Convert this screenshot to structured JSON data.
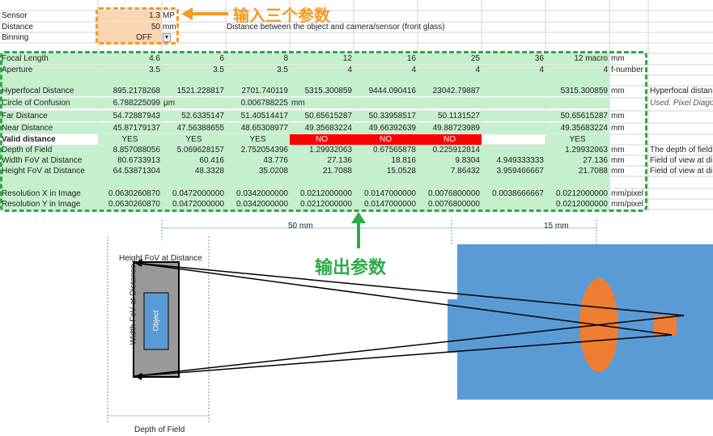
{
  "inputs": {
    "sensor": {
      "label": "Sensor",
      "value": "1.3",
      "unit": "MP"
    },
    "distance": {
      "label": "Distance",
      "value": "50",
      "unit": "mm",
      "note": "Distance between the object and camera/sensor (front glass)"
    },
    "binning": {
      "label": "Binning",
      "value": "OFF"
    }
  },
  "callouts": {
    "input": "输入三个参数",
    "output": "输出参数"
  },
  "rows": {
    "focal": {
      "label": "Focal Length",
      "values": [
        "4.6",
        "6",
        "8",
        "12",
        "16",
        "25",
        "36",
        "12 macro"
      ],
      "unit": "mm"
    },
    "aperture": {
      "label": "Aperture",
      "values": [
        "3.5",
        "3.5",
        "3.5",
        "4",
        "4",
        "4",
        "4",
        "4"
      ],
      "unit": "f-number"
    },
    "hyperfocal": {
      "label": "Hyperfocal Distance",
      "values": [
        "895.2178268",
        "1521.228817",
        "2701.740119",
        "5315.300859",
        "9444.090416",
        "23042.79887",
        "",
        "5315.300859"
      ],
      "unit": "mm",
      "note": "Hyperfocal distan"
    },
    "coc": {
      "label": "Circle of Confusion",
      "v1": "6.788225099",
      "u1": "μm",
      "v2": "0.006788225",
      "u2": "mm",
      "note": "Used. Pixel Diago"
    },
    "far": {
      "label": "Far Distance",
      "values": [
        "54.72887943",
        "52.6335147",
        "51.40514417",
        "50.65615287",
        "50.33958517",
        "50.1131527",
        "",
        "50.65615287"
      ],
      "unit": "mm"
    },
    "near": {
      "label": "Near Distance",
      "values": [
        "45.87179137",
        "47.56388655",
        "48.65308977",
        "49.35683224",
        "49.66392639",
        "49.88723989",
        "",
        "49.35683224"
      ],
      "unit": "mm"
    },
    "valid": {
      "label": "Valid distance",
      "values": [
        "YES",
        "YES",
        "YES",
        "NO",
        "NO",
        "NO",
        "",
        "YES"
      ]
    },
    "dof": {
      "label": "Depth of Field",
      "values": [
        "8.857088056",
        "5.069628157",
        "2.752054396",
        "1.29932063",
        "0.67565878",
        "0.225912814",
        "",
        "1.29932063"
      ],
      "unit": "mm",
      "note": "The depth of field"
    },
    "width": {
      "label": "Width FoV at  Distance",
      "values": [
        "80.6733913",
        "60.416",
        "43.776",
        "27.136",
        "18.816",
        "9.8304",
        "4.949333333",
        "27.136"
      ],
      "unit": "mm",
      "note": "Field of view at di"
    },
    "height": {
      "label": "Height FoV at  Distance",
      "values": [
        "64.53871304",
        "48.3328",
        "35.0208",
        "21.7088",
        "15.0528",
        "7.86432",
        "3.959466667",
        "21.7088"
      ],
      "unit": "mm",
      "note": "Field of view at di"
    },
    "resx": {
      "label": "Resolution X  in Image",
      "values": [
        "0.0630260870",
        "0.0472000000",
        "0.0342000000",
        "0.0212000000",
        "0.0147000000",
        "0.0076800000",
        "0.0038666667",
        "0.0212000000"
      ],
      "unit": "mm/pixel"
    },
    "resy": {
      "label": "Resolution Y in Image",
      "values": [
        "0.0630260870",
        "0.0472000000",
        "0.0342000000",
        "0.0212000000",
        "0.0147000000",
        "0.0076800000",
        "",
        "0.0212000000"
      ],
      "unit": "mm/pixel"
    }
  },
  "diagram": {
    "dim_50": "50 mm",
    "dim_15": "15 mm",
    "height_label": "Height FoV at  Distance",
    "width_label": "Width FoV at  Distance",
    "object_label": "Object",
    "dof_label": "Depth of Field"
  },
  "colors": {
    "orange": "#f59a23",
    "green": "#2eaa47",
    "blue": "#5b9bd5",
    "lens": "#ed7d31"
  }
}
